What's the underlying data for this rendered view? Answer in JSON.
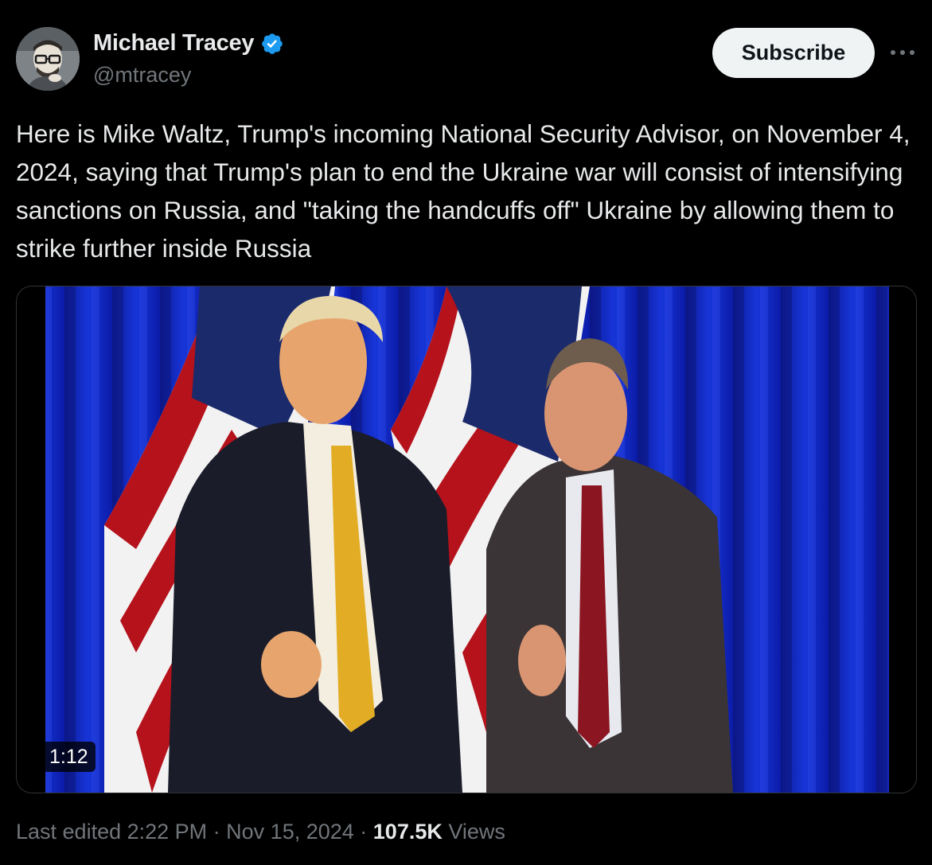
{
  "author": {
    "display_name": "Michael Tracey",
    "handle": "@mtracey",
    "verified": true,
    "avatar_icon": "cartoon-avatar-icon"
  },
  "actions": {
    "subscribe_label": "Subscribe",
    "more_icon": "more-icon"
  },
  "tweet": {
    "text": "Here is Mike Waltz, Trump's incoming National Security Advisor, on November 4, 2024, saying that Trump's plan to end the Ukraine war will consist of intensifying sanctions on Russia, and \"taking the handcuffs off\" Ukraine by allowing them to strike further inside Russia"
  },
  "media": {
    "type": "video",
    "duration": "1:12"
  },
  "footer": {
    "edited_label": "Last edited 2:22 PM",
    "separator": " · ",
    "date": "Nov 15, 2024",
    "views_count": "107.5K",
    "views_label": "Views"
  },
  "colors": {
    "background": "#000000",
    "text_primary": "#e7e9ea",
    "text_secondary": "#71767b",
    "verified_blue": "#1d9bf0",
    "button_bg": "#eff3f4"
  }
}
